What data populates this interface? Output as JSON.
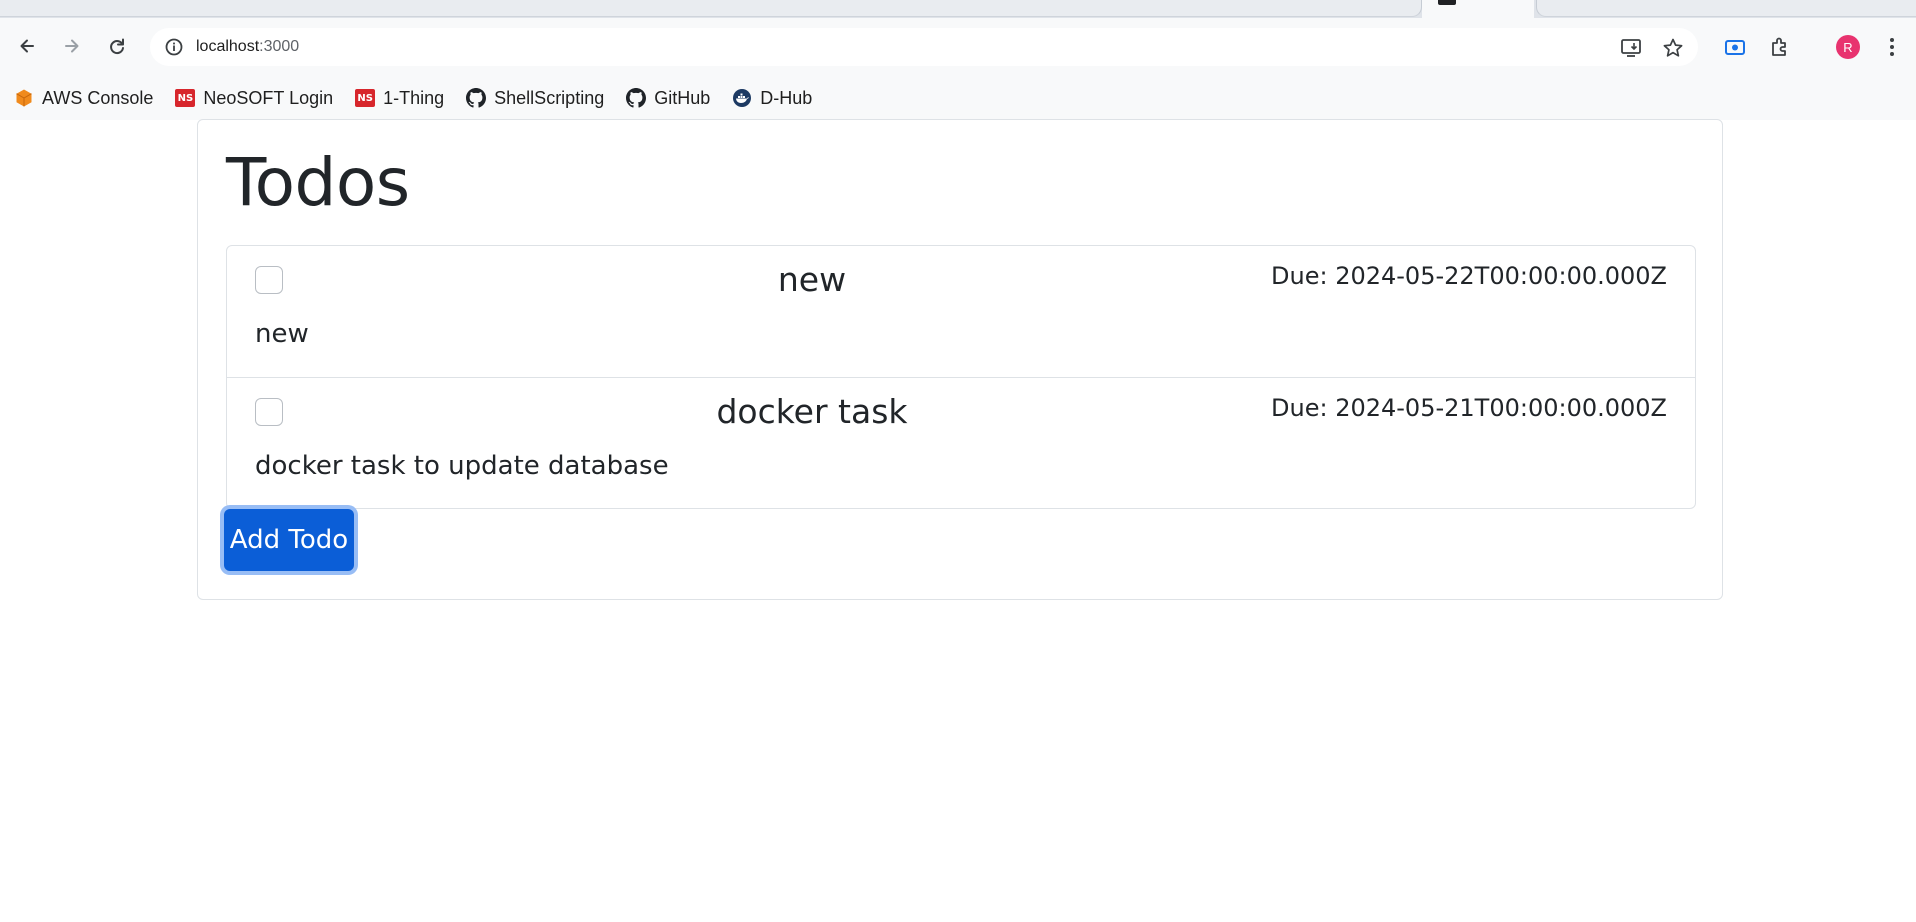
{
  "browser": {
    "url_host": "localhost",
    "url_port": ":3000",
    "profile_initial": "R",
    "bookmarks": [
      {
        "label": "AWS Console",
        "icon": "aws-cube-icon"
      },
      {
        "label": "NeoSOFT Login",
        "icon": "ns-badge-icon",
        "badge": "NS"
      },
      {
        "label": "1-Thing",
        "icon": "ns-badge-icon",
        "badge": "NS"
      },
      {
        "label": "ShellScripting",
        "icon": "github-icon"
      },
      {
        "label": "GitHub",
        "icon": "github-icon"
      },
      {
        "label": "D-Hub",
        "icon": "docker-hub-icon"
      }
    ]
  },
  "page": {
    "title": "Todos",
    "todos": [
      {
        "title": "new",
        "due": "Due: 2024-05-22T00:00:00.000Z",
        "description": "new",
        "completed": false
      },
      {
        "title": "docker task",
        "due": "Due: 2024-05-21T00:00:00.000Z",
        "description": "docker task to update database",
        "completed": false
      }
    ],
    "add_button_label": "Add Todo"
  },
  "colors": {
    "primary": "#0b5ed7",
    "profile": "#e8336f",
    "ns_badge": "#d7262c",
    "aws": "#f08a1c"
  }
}
